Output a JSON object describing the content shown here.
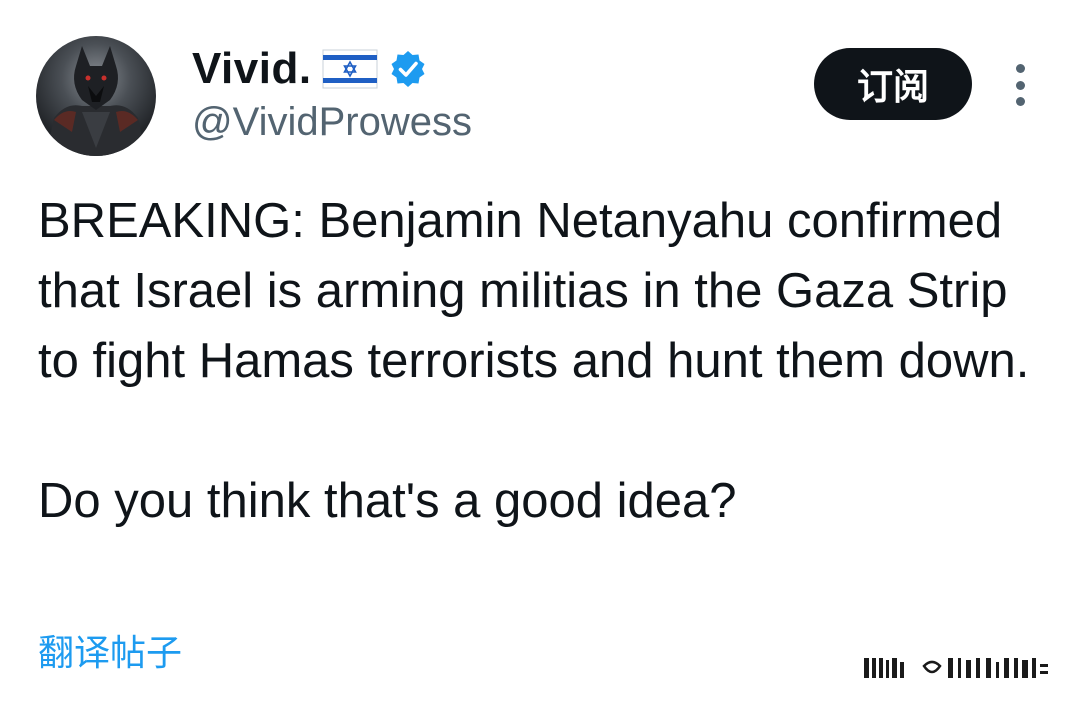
{
  "author": {
    "display_name": "Vivid.",
    "handle": "@VividProwess",
    "flag_icon": "israel-flag-icon",
    "verified_icon": "verified-badge-icon",
    "verified_color": "#1d9bf0",
    "avatar": "wolf-warrior-avatar"
  },
  "actions": {
    "subscribe_label": "订阅",
    "more_icon": "more-vertical-icon"
  },
  "tweet": {
    "paragraph_1": "BREAKING: Benjamin Netanyahu confirmed that Israel is arming militias in the Gaza Strip to fight Hamas terrorists and hunt them down.",
    "paragraph_2": "Do you think that's a good idea?",
    "translate_label": "翻译帖子"
  },
  "colors": {
    "text": "#0f1419",
    "secondary": "#536471",
    "link": "#1d9bf0",
    "button_bg": "#0f1419"
  }
}
